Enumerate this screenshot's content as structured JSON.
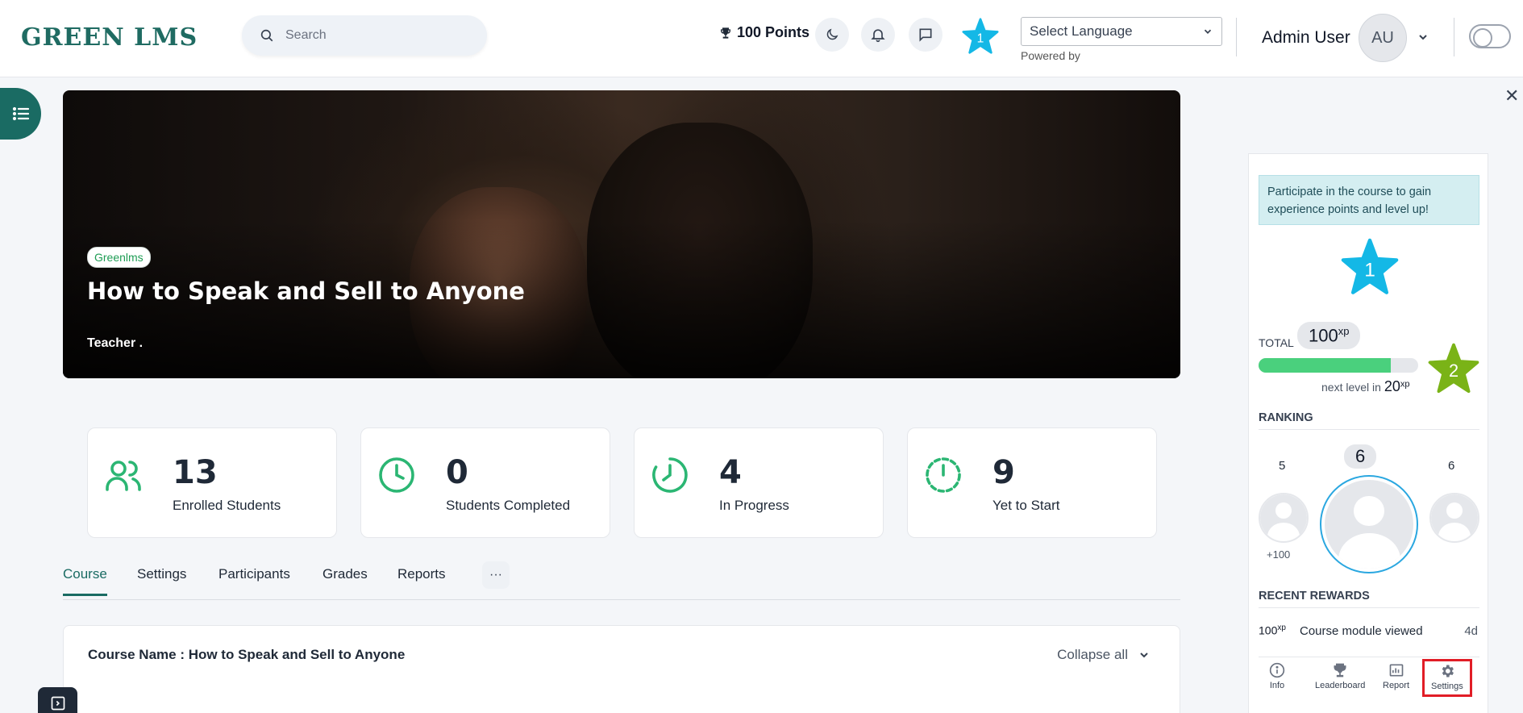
{
  "header": {
    "logo": "GREEN LMS",
    "search_placeholder": "Search",
    "points": "100 Points",
    "level": "1",
    "language_select": "Select Language",
    "powered_by": "Powered by",
    "user_name": "Admin User",
    "avatar_initials": "AU"
  },
  "hero": {
    "badge": "Greenlms",
    "title": "How to Speak and Sell to Anyone",
    "teacher": "Teacher ."
  },
  "stats": [
    {
      "value": "13",
      "label": "Enrolled Students"
    },
    {
      "value": "0",
      "label": "Students Completed"
    },
    {
      "value": "4",
      "label": "In Progress"
    },
    {
      "value": "9",
      "label": "Yet to Start"
    }
  ],
  "tabs": {
    "course": "Course",
    "settings": "Settings",
    "participants": "Participants",
    "grades": "Grades",
    "reports": "Reports",
    "more": "···"
  },
  "course": {
    "name": "Course Name : How to Speak and Sell to Anyone",
    "collapse_all": "Collapse all"
  },
  "panel": {
    "message": "Participate in the course to gain experience points and level up!",
    "current_level": "1",
    "total_label": "TOTAL",
    "total_value": "100",
    "xp_unit": "xp",
    "progress_fraction": 0.83,
    "next_level_label": "next level in",
    "next_level_value": "20",
    "next_level": "2",
    "ranking_title": "RANKING",
    "rank_left": "5",
    "rank_center": "6",
    "rank_right": "6",
    "rank_left_gain": "+100",
    "recent_rewards_title": "RECENT REWARDS",
    "reward_xp": "100",
    "reward_desc": "Course module viewed",
    "reward_time": "4d",
    "nav": {
      "info": "Info",
      "leaderboard": "Leaderboard",
      "report": "Report",
      "settings": "Settings"
    }
  },
  "colors": {
    "brand": "#1a6b63",
    "stat_icon": "#2bb673",
    "star_blue": "#14b8e6",
    "star_green": "#7ab317",
    "progress": "#4ad07d",
    "highlight": "#e11d26"
  },
  "icons": [
    "search-icon",
    "trophy-icon",
    "moon-icon",
    "bell-icon",
    "chat-icon",
    "chevron-down-icon",
    "list-icon",
    "close-icon",
    "users-icon",
    "clock-icon",
    "clock-progress-icon",
    "timer-icon",
    "info-icon",
    "leaderboard-trophy-icon",
    "report-icon",
    "gear-icon",
    "sidebar-toggle-icon"
  ]
}
